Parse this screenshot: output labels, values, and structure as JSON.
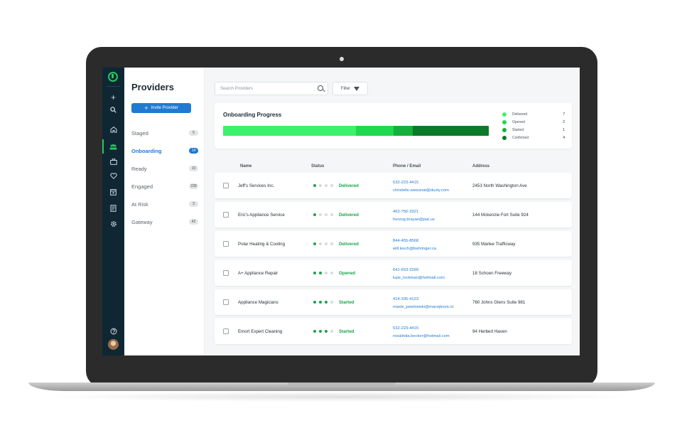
{
  "sidebar": {
    "title": "Providers",
    "invite_label": "Invite Provider",
    "items": [
      {
        "label": "Staged",
        "count": "5"
      },
      {
        "label": "Onboarding",
        "count": "14"
      },
      {
        "label": "Ready",
        "count": "10"
      },
      {
        "label": "Engaged",
        "count": "228"
      },
      {
        "label": "At Risk",
        "count": "3"
      },
      {
        "label": "Gateway",
        "count": "42"
      }
    ]
  },
  "rail": {
    "icons": [
      "plus-icon",
      "search-icon",
      "home-icon",
      "people-icon",
      "briefcase-icon",
      "heart-icon",
      "calendar-icon",
      "document-icon",
      "gear-icon",
      "help-icon"
    ]
  },
  "toolbar": {
    "search_placeholder": "Search Providers",
    "filter_label": "Filter"
  },
  "progress": {
    "title": "Onboarding Progress",
    "legend": [
      {
        "label": "Delivered",
        "count": "7",
        "color": "#3df26b"
      },
      {
        "label": "Opened",
        "count": "2",
        "color": "#1fd94f"
      },
      {
        "label": "Started",
        "count": "1",
        "color": "#15b03c"
      },
      {
        "label": "Confirmed",
        "count": "4",
        "color": "#0b7a2a"
      }
    ]
  },
  "table": {
    "headers": {
      "name": "Name",
      "status": "Status",
      "contact": "Phone / Email",
      "address": "Address"
    },
    "rows": [
      {
        "name": "Jeff's Services Inc.",
        "status": "Delivered",
        "dots": 1,
        "phone": "532-223-4415",
        "email": "christelle.weissnat@dusty.com",
        "address": "2453 North Washington Ave"
      },
      {
        "name": "Eric's Appliance Service",
        "status": "Delivered",
        "dots": 1,
        "phone": "462-756-3321",
        "email": "herzog.brayan@pat.us",
        "address": "144 Mckenzie Fort Suite 924"
      },
      {
        "name": "Polar Heating & Cooling",
        "status": "Delivered",
        "dots": 1,
        "phone": "844-455-8568",
        "email": "will.lesch@bahringer.ca",
        "address": "935 Marlee Trafficway"
      },
      {
        "name": "A+ Appliance Repair",
        "status": "Opened",
        "dots": 2,
        "phone": "641-653-2399",
        "email": "lupe_lockman@hotmail.com",
        "address": "18 Schoen Freeway"
      },
      {
        "name": "Appliance Magicians",
        "status": "Started",
        "dots": 3,
        "phone": "414-335-4123",
        "email": "maxie_powlowski@macejkovic.tv",
        "address": "760 Johns Glens Suite 981"
      },
      {
        "name": "Emort Expert Cleaning",
        "status": "Started",
        "dots": 3,
        "phone": "532-223-4415",
        "email": "rosalinda.becker@hotmail.com",
        "address": "94 Herbert Haven"
      }
    ]
  }
}
